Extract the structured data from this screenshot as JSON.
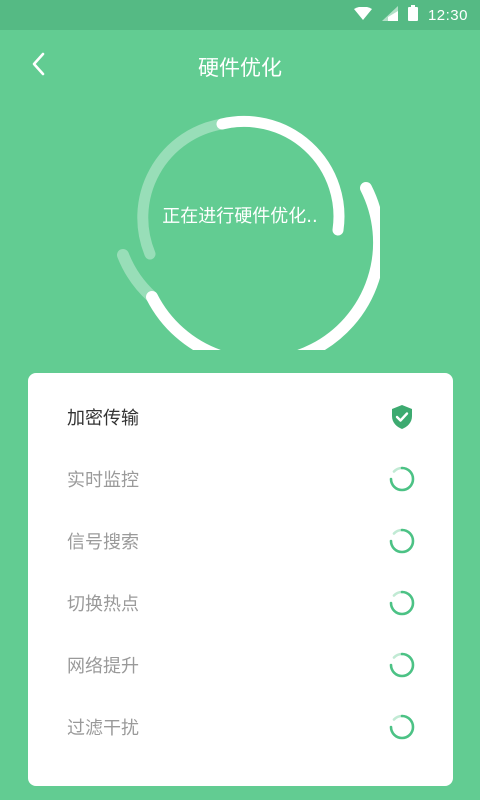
{
  "status_bar": {
    "time": "12:30"
  },
  "app_bar": {
    "title": "硬件优化"
  },
  "progress": {
    "label": "正在进行硬件优化..",
    "fraction": 0.72
  },
  "colors": {
    "primary": "#62cc92",
    "status_bar": "#55ba84",
    "check": "#3daa70",
    "spinner": "#4cc285"
  },
  "tasks": [
    {
      "label": "加密传输",
      "status": "done"
    },
    {
      "label": "实时监控",
      "status": "loading"
    },
    {
      "label": "信号搜索",
      "status": "loading"
    },
    {
      "label": "切换热点",
      "status": "loading"
    },
    {
      "label": "网络提升",
      "status": "loading"
    },
    {
      "label": "过滤干扰",
      "status": "loading"
    }
  ]
}
